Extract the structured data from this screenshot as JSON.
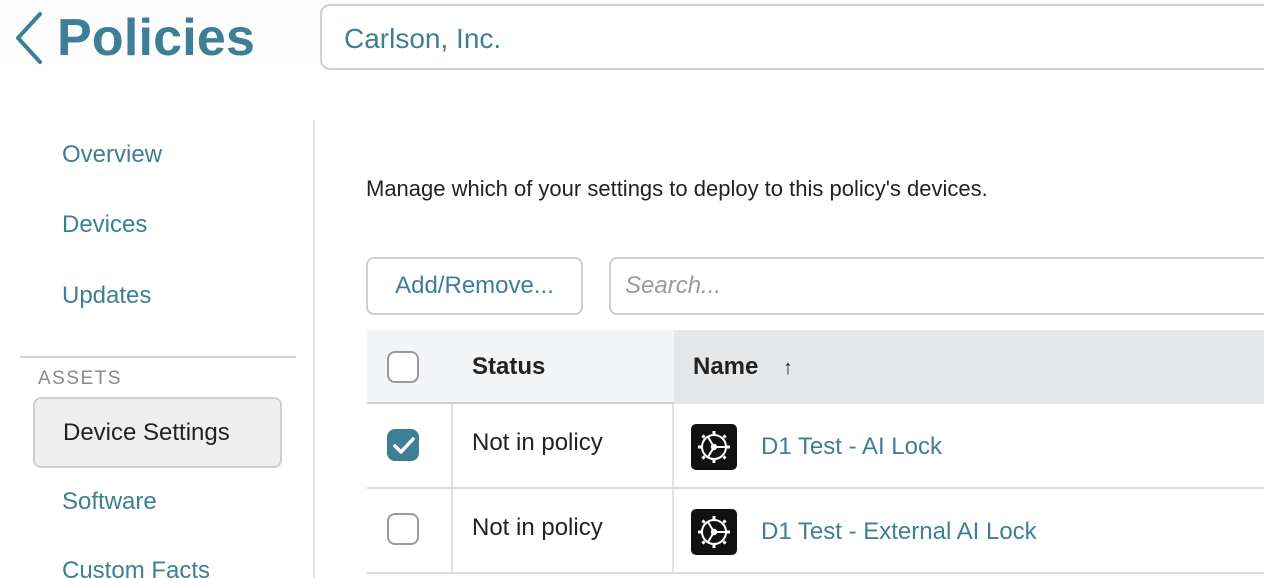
{
  "header": {
    "title": "Policies",
    "organization": "Carlson, Inc."
  },
  "sidebar": {
    "items": [
      {
        "label": "Overview"
      },
      {
        "label": "Devices"
      },
      {
        "label": "Updates"
      }
    ],
    "section_label": "ASSETS",
    "assets": [
      {
        "label": "Device Settings",
        "active": true
      },
      {
        "label": "Software"
      },
      {
        "label": "Custom Facts"
      }
    ]
  },
  "main": {
    "description": "Manage which of your settings to deploy to this policy's devices.",
    "add_remove_label": "Add/Remove...",
    "search_placeholder": "Search...",
    "table": {
      "columns": {
        "status": "Status",
        "name": "Name",
        "sort_indicator": "↑"
      },
      "rows": [
        {
          "checked": true,
          "status": "Not in policy",
          "name": "D1 Test - AI Lock",
          "icon": "gear-icon"
        },
        {
          "checked": false,
          "status": "Not in policy",
          "name": "D1 Test - External AI Lock",
          "icon": "gear-icon"
        }
      ]
    }
  },
  "colors": {
    "accent": "#3e7f95",
    "header_bg": "#f3f4f5",
    "sorted_header_bg": "#e6e7e8"
  }
}
